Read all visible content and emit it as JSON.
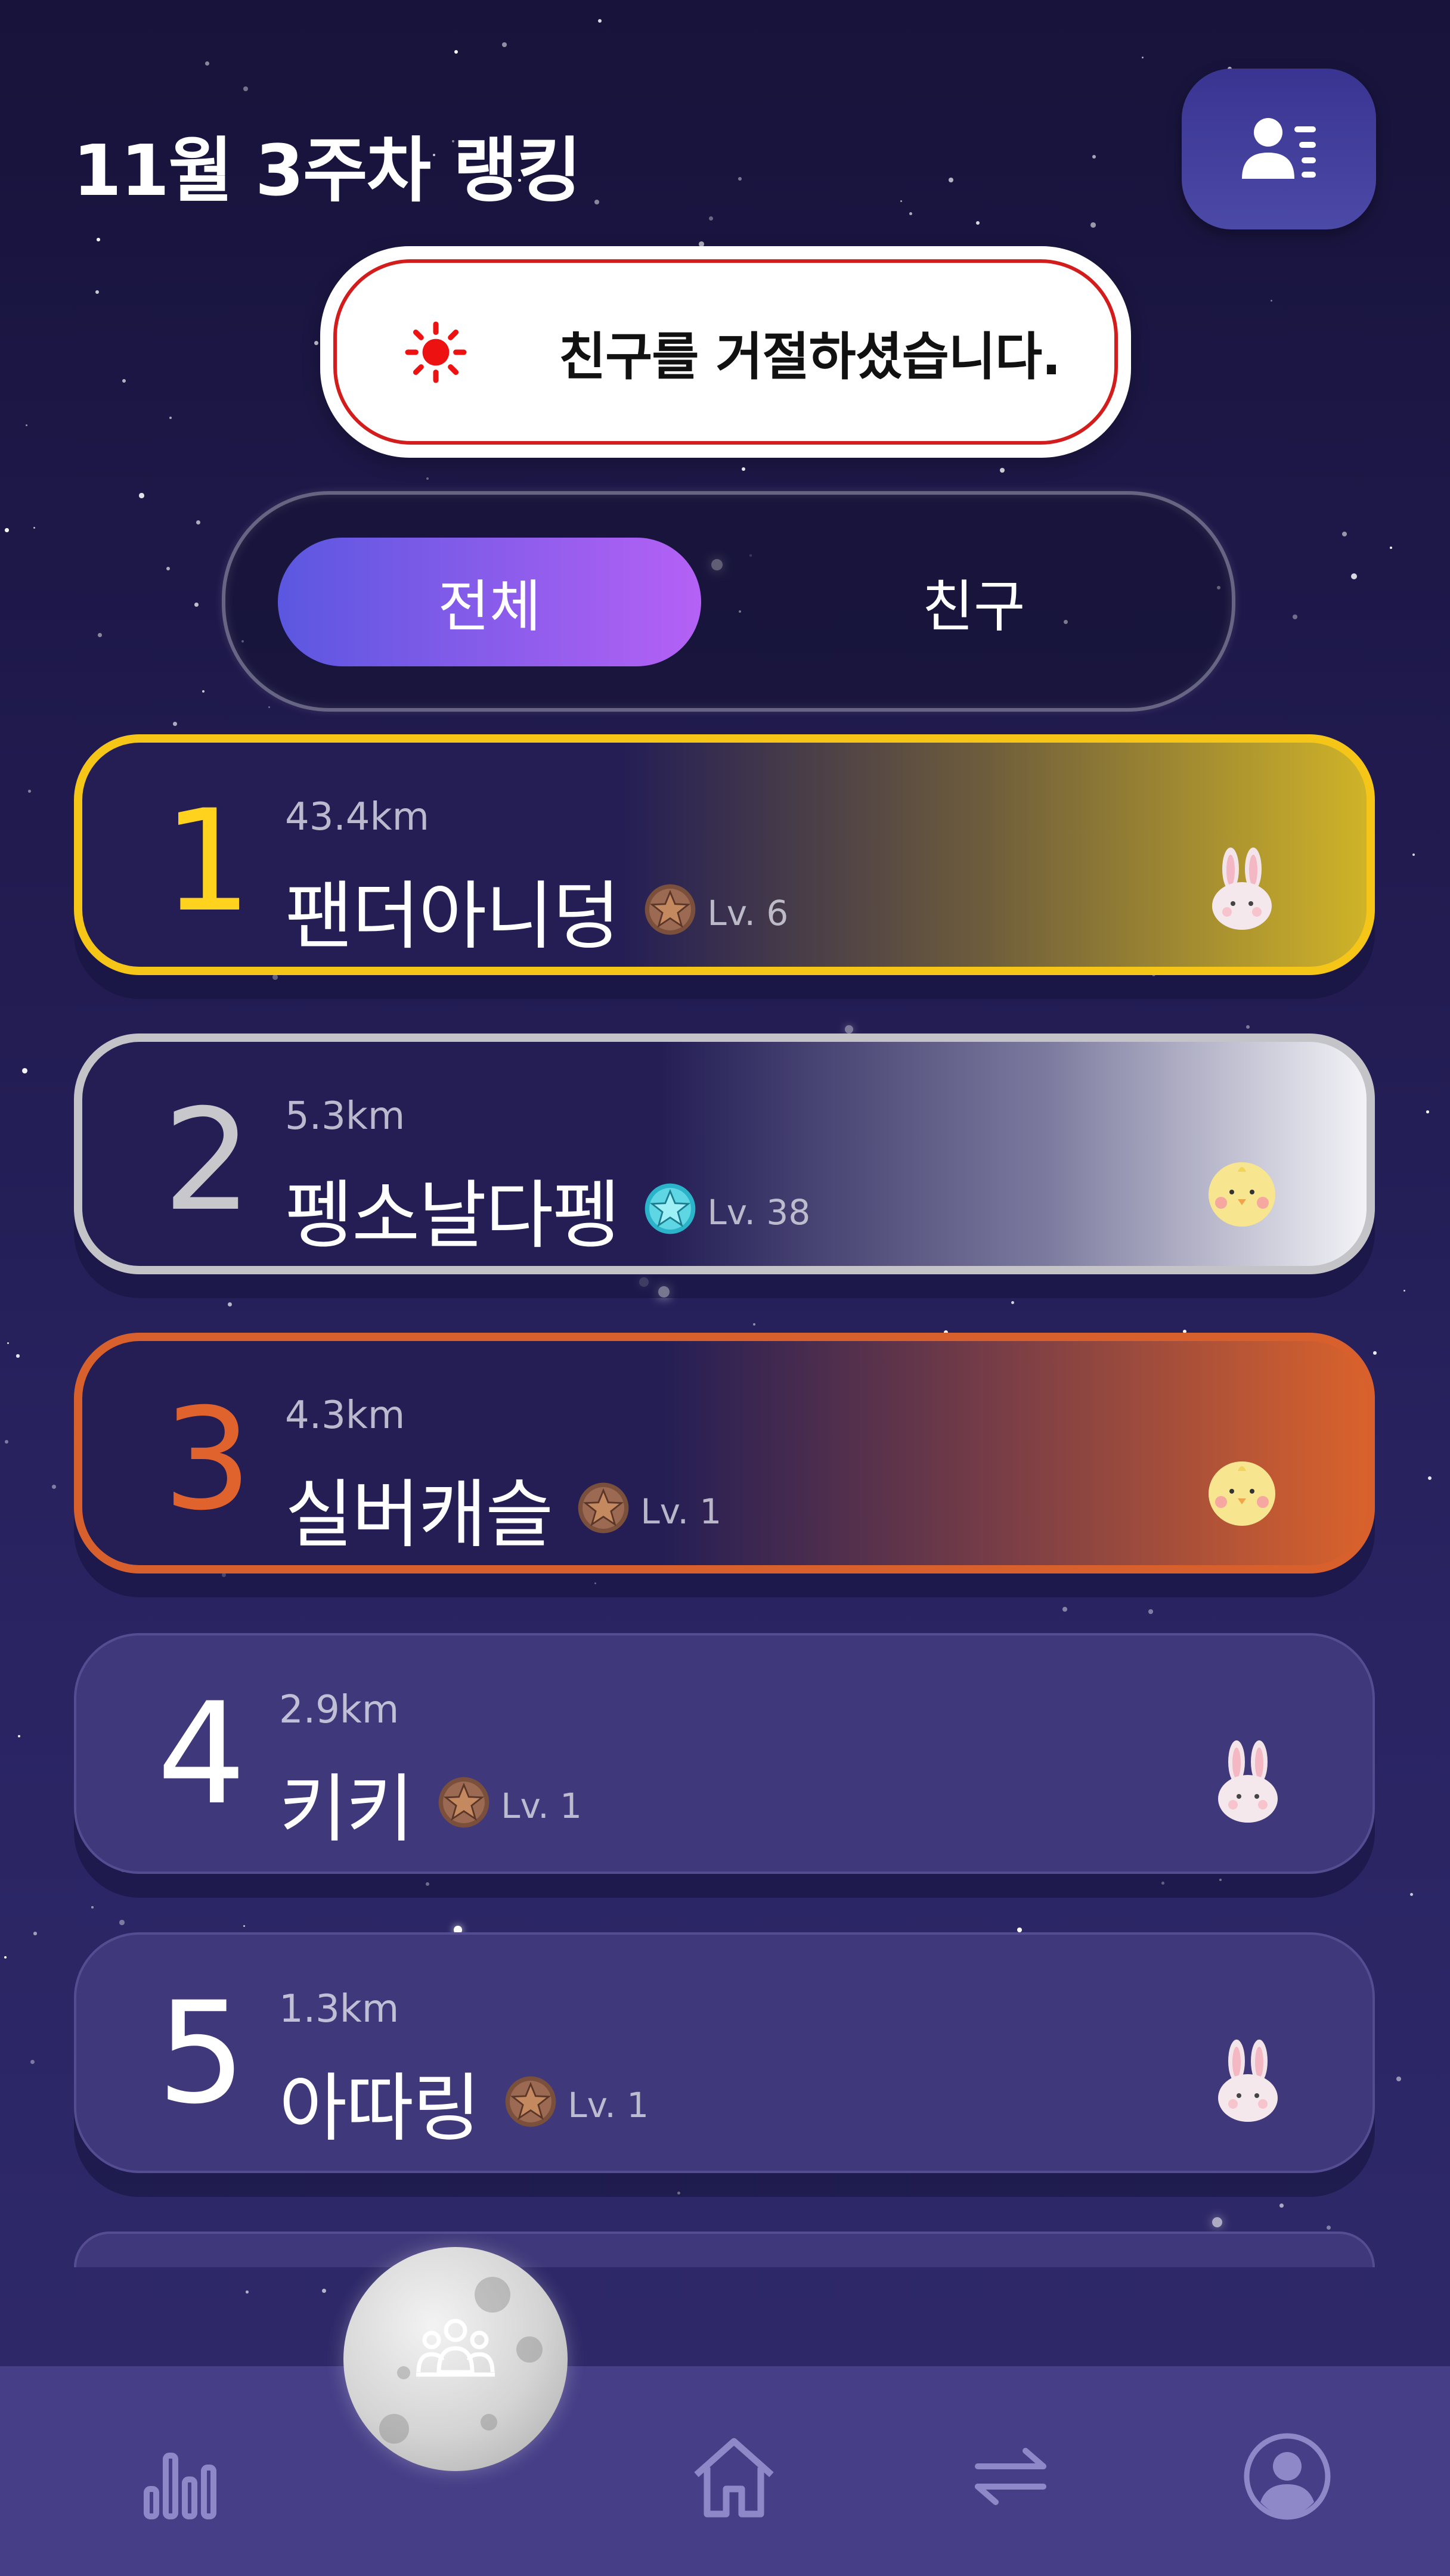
{
  "header": {
    "title": "11월 3주차 랭킹"
  },
  "toast": {
    "message": "친구를 거절하셨습니다."
  },
  "segment": {
    "tabs": [
      "전체",
      "친구"
    ],
    "selected": "전체"
  },
  "ranking": [
    {
      "rank": "1",
      "distance": "43.4km",
      "nickname": "팬더아니덩",
      "level": "Lv. 6",
      "badge": "bronze-star",
      "avatar": "bunny"
    },
    {
      "rank": "2",
      "distance": "5.3km",
      "nickname": "펭소날다펭",
      "level": "Lv. 38",
      "badge": "cyan-star",
      "avatar": "chick"
    },
    {
      "rank": "3",
      "distance": "4.3km",
      "nickname": "실버캐슬",
      "level": "Lv. 1",
      "badge": "bronze-star",
      "avatar": "chick"
    },
    {
      "rank": "4",
      "distance": "2.9km",
      "nickname": "키키",
      "level": "Lv. 1",
      "badge": "bronze-star",
      "avatar": "bunny"
    },
    {
      "rank": "5",
      "distance": "1.3km",
      "nickname": "아따링",
      "level": "Lv. 1",
      "badge": "bronze-star",
      "avatar": "bunny"
    }
  ],
  "nav": {
    "items": [
      "ranking-chart-icon",
      "friends-moon-button",
      "home-icon",
      "exchange-icon",
      "profile-icon"
    ],
    "active": "friends-moon-button"
  },
  "colors": {
    "gold": "#f5c518",
    "silver": "#c3c3c8",
    "bronze": "#d7602d",
    "accent_start": "#5b57e0",
    "accent_end": "#b561f5"
  }
}
